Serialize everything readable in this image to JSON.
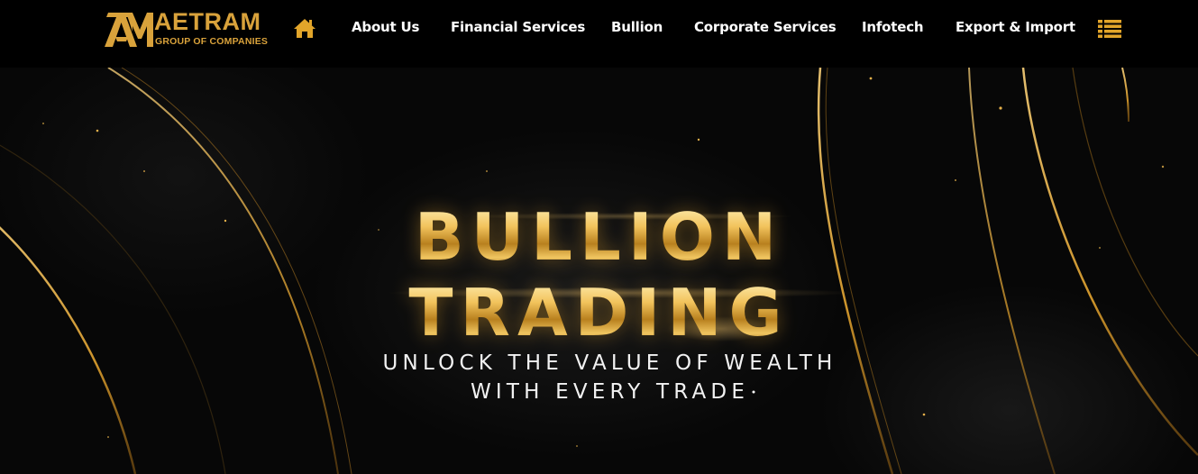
{
  "brand": {
    "name": "AETRAM",
    "tagline": "GROUP OF COMPANIES",
    "mark_letters": "AM",
    "gold": "#d9a23b"
  },
  "nav": {
    "home_icon": "home-icon",
    "items": [
      {
        "label": "About Us"
      },
      {
        "label": "Financial Services"
      },
      {
        "label": "Bullion"
      },
      {
        "label": "Corporate Services"
      },
      {
        "label": "Infotech"
      },
      {
        "label": "Export & Import"
      }
    ],
    "menu_icon": "list-menu-icon",
    "text_color": "#ffffff",
    "icon_color": "#e2a52a"
  },
  "hero": {
    "title_line1": "BULLION",
    "title_line2": "TRADING",
    "subtitle_line1": "UNLOCK THE VALUE OF WEALTH",
    "subtitle_line2": "WITH EVERY TRADE",
    "title_color": "#e6b34a",
    "background_color": "#070707"
  }
}
